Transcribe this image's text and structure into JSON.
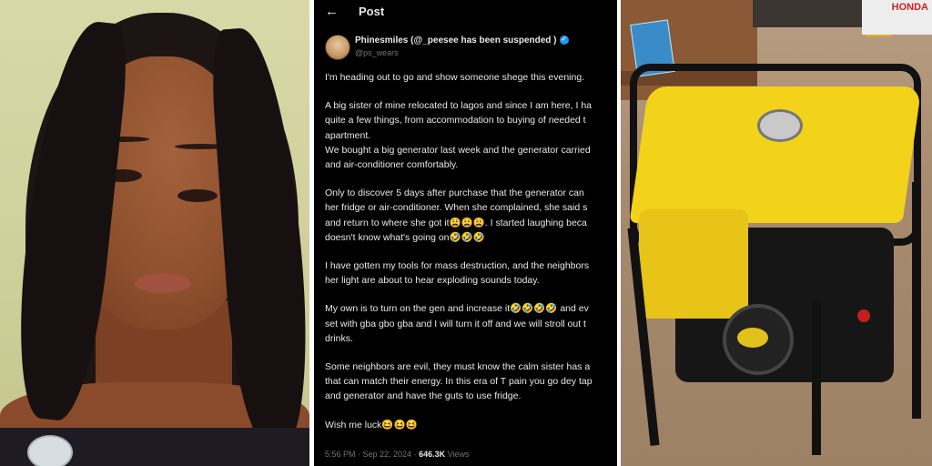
{
  "post": {
    "header_title": "Post",
    "back_label": "←",
    "author_name": "Phinesmiles (@_peesee has been suspended )",
    "verified_mark": "✓",
    "author_handle": "@ps_wears",
    "lines": [
      "I'm heading out to go and show someone shege this evening.",
      "",
      "A big sister of mine relocated to lagos and since I am here, I ha",
      "quite a few things, from accommodation to buying of needed t",
      "apartment.",
      "We bought a big generator last week and the generator carried",
      "and air-conditioner comfortably.",
      "",
      "Only to discover 5 days after purchase that the generator can",
      "her fridge or air-conditioner. When she complained, she said s",
      "and return to where she got it😩😩😩.  I started laughing beca",
      "doesn't know what's going on🤣🤣🤣",
      "",
      "I have gotten my tools for mass destruction, and the neighbors",
      "her light are about to hear exploding sounds today.",
      "",
      "My own is to turn on the gen and increase it🤣🤣🤣🤣 and ev",
      "set with gba gbo gba and I will turn it off and we will stroll out t",
      "drinks.",
      "",
      "Some neighbors are evil, they must know the calm sister has a",
      "that can match their energy. In this era of T pain you go dey tap",
      "and generator and have the guts to use fridge.",
      "",
      "Wish me luck😆😆😆"
    ],
    "footer_time": "5:56 PM · Sep 22, 2024 · ",
    "footer_views_count": "646.3K",
    "footer_views_label": " Views"
  },
  "generator_scene": {
    "shop_sign_text": "HONDA"
  }
}
